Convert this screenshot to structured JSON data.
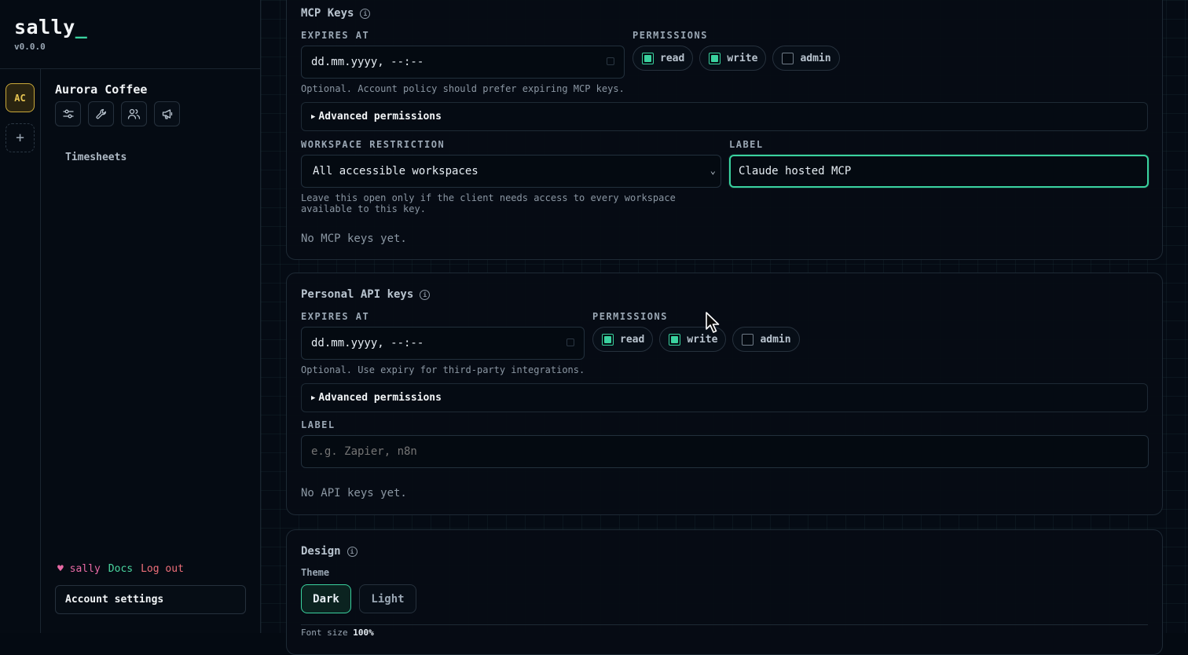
{
  "app": {
    "name": "sally",
    "cursor_char": "_",
    "version": "v0.0.0"
  },
  "rail": {
    "workspace_initials": "AC",
    "add_label": "+"
  },
  "workspace": {
    "name": "Aurora Coffee",
    "tools": [
      "sliders-icon",
      "wrench-icon",
      "users-icon",
      "megaphone-icon"
    ],
    "nav_items": [
      "Timesheets"
    ]
  },
  "footer": {
    "heart": "♥",
    "user": "sally",
    "docs": "Docs",
    "logout": "Log out",
    "account_settings": "Account settings"
  },
  "mcp_keys": {
    "title": "MCP Keys",
    "expires_label": "EXPIRES AT",
    "expires_value": "dd.mm.yyyy, --:--",
    "expires_hint": "Optional. Account policy should prefer expiring MCP keys.",
    "permissions_label": "PERMISSIONS",
    "permissions": [
      {
        "label": "read",
        "checked": true
      },
      {
        "label": "write",
        "checked": true
      },
      {
        "label": "admin",
        "checked": false
      }
    ],
    "advanced_label": "Advanced permissions",
    "workspace_restriction_label": "WORKSPACE RESTRICTION",
    "workspace_restriction_value": "All accessible workspaces",
    "workspace_restriction_hint_1": "Leave this open only if the client needs access to every workspace",
    "workspace_restriction_hint_2": "available to this key.",
    "label_label": "LABEL",
    "label_value": "Claude hosted MCP",
    "empty": "No MCP keys yet."
  },
  "api_keys": {
    "title": "Personal API keys",
    "expires_label": "EXPIRES AT",
    "expires_value": "dd.mm.yyyy, --:--",
    "expires_hint": "Optional. Use expiry for third-party integrations.",
    "permissions_label": "PERMISSIONS",
    "permissions": [
      {
        "label": "read",
        "checked": true
      },
      {
        "label": "write",
        "checked": true
      },
      {
        "label": "admin",
        "checked": false
      }
    ],
    "advanced_label": "Advanced permissions",
    "label_label": "LABEL",
    "label_placeholder": "e.g. Zapier, n8n",
    "empty": "No API keys yet."
  },
  "design": {
    "title": "Design",
    "theme_label": "Theme",
    "theme_options": [
      "Dark",
      "Light"
    ],
    "theme_selected": "Dark",
    "font_size_label": "Font size",
    "font_size_value": "100%"
  },
  "colors": {
    "accent": "#3ad29f",
    "workspace_badge": "#e7c552",
    "heart": "#e86aa5",
    "logout": "#ef6f7a"
  }
}
